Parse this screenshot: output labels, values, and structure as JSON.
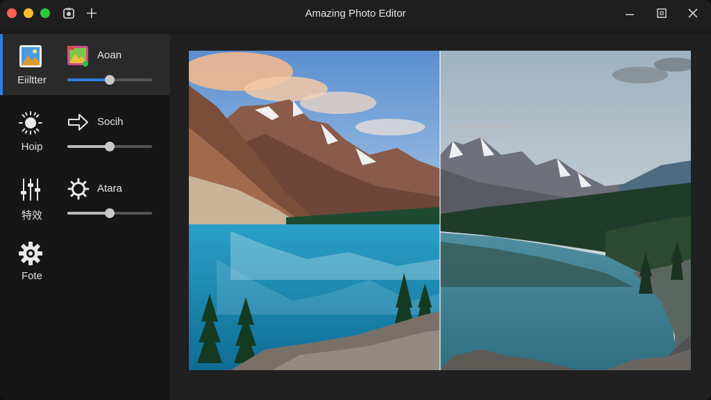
{
  "window": {
    "title": "Amazing Photo Editor"
  },
  "sidebar": {
    "tools": [
      {
        "label": "Eiiltter",
        "icon": "photo-icon",
        "active": true,
        "adjust": {
          "label": "Aoan",
          "icon": "colorful-image-icon",
          "value": 0.5
        }
      },
      {
        "label": "Hoip",
        "icon": "sun-icon",
        "adjust": {
          "label": "Socih",
          "icon": "arrow-right-icon",
          "value": 0.5
        }
      },
      {
        "label": "特效",
        "icon": "sliders-icon",
        "adjust": {
          "label": "Atara",
          "icon": "gear-icon",
          "value": 0.5
        }
      },
      {
        "label": "Fote",
        "icon": "cog-icon"
      }
    ]
  },
  "colors": {
    "accent": "#2f7fe0",
    "sidebar_bg": "#161616",
    "active_bg": "#2a2a2a"
  },
  "canvas": {
    "split_position": 0.5
  }
}
